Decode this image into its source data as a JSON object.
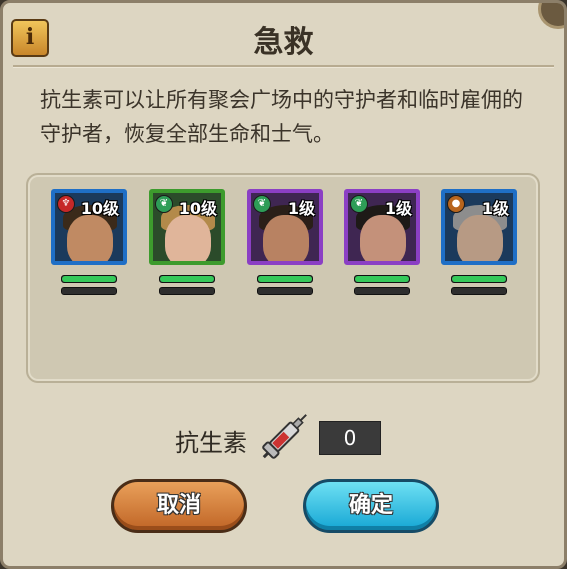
{
  "dialog": {
    "title": "急救",
    "info_icon": "info-icon",
    "description": "抗生素可以让所有聚会广场中的守护者和临时雇佣的守护者，恢复全部生命和士气。"
  },
  "heroes": [
    {
      "level": "10级",
      "frame_color": "#1f6fc6",
      "class_icon": "shield-icon",
      "health": 1.0,
      "morale": 1.0
    },
    {
      "level": "10级",
      "frame_color": "#3d9b2d",
      "class_icon": "leaf-icon",
      "health": 1.0,
      "morale": 1.0
    },
    {
      "level": "1级",
      "frame_color": "#8b3fc4",
      "class_icon": "leaf-icon",
      "health": 1.0,
      "morale": 1.0
    },
    {
      "level": "1级",
      "frame_color": "#8b3fc4",
      "class_icon": "leaf-icon",
      "health": 1.0,
      "morale": 1.0
    },
    {
      "level": "1级",
      "frame_color": "#1f6fc6",
      "class_icon": "orb-icon",
      "health": 1.0,
      "morale": 1.0
    }
  ],
  "item": {
    "label": "抗生素",
    "icon": "syringe-icon",
    "count": "0"
  },
  "buttons": {
    "cancel": "取消",
    "confirm": "确定"
  },
  "colors": {
    "health_bar": "#35c95a",
    "cancel_button": "#d7823e",
    "confirm_button": "#33c1e6"
  }
}
